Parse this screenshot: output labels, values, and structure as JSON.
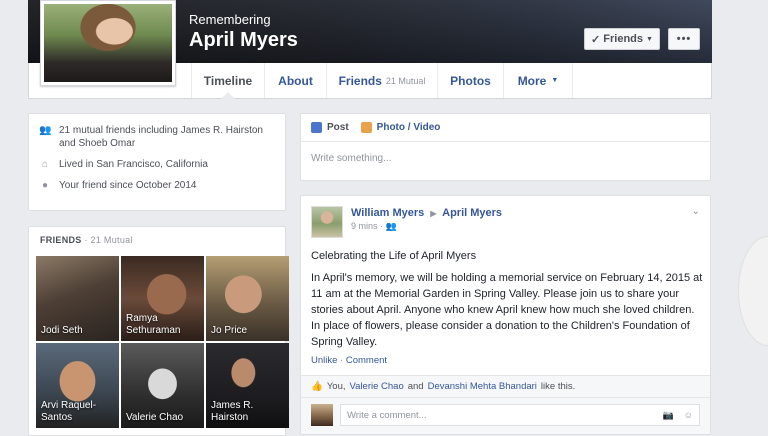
{
  "header": {
    "remembering": "Remembering",
    "name": "April Myers",
    "friends_button": "Friends",
    "more_button": "•••"
  },
  "tabs": [
    {
      "label": "Timeline",
      "sub": ""
    },
    {
      "label": "About",
      "sub": ""
    },
    {
      "label": "Friends",
      "sub": "21 Mutual"
    },
    {
      "label": "Photos",
      "sub": ""
    },
    {
      "label": "More",
      "sub": ""
    }
  ],
  "intro": {
    "mutual": "21 mutual friends including James R. Hairston and Shoeb Omar",
    "lived": "Lived in San Francisco, California",
    "since": "Your friend since October 2014"
  },
  "friends": {
    "title": "FRIENDS",
    "mutual": "· 21 Mutual",
    "people": [
      "Jodi Seth",
      "Ramya Sethuraman",
      "Jo Price",
      "Arvi Raquel-Santos",
      "Valerie Chao",
      "James R. Hairston"
    ]
  },
  "composer": {
    "post_tab": "Post",
    "photo_tab": "Photo / Video",
    "placeholder": "Write something..."
  },
  "post": {
    "author": "William Myers",
    "target": "April Myers",
    "time": "9 mins",
    "title": "Celebrating the Life of April Myers",
    "body": "In April's memory, we will be holding a memorial service on February 14, 2015 at 11 am at the Memorial Garden in Spring Valley. Please join us to share your stories about April. Anyone who knew April knew how much she loved children. In place of flowers, please consider a donation to the Children's Foundation of Spring Valley.",
    "unlike": "Unlike",
    "comment": "Comment",
    "likes_prefix": "You, ",
    "likes_name1": "Valerie Chao",
    "likes_and": " and ",
    "likes_name2": "Devanshi Mehta Bhandari",
    "likes_suffix": " like this.",
    "comment_placeholder": "Write a comment..."
  },
  "colors": {
    "link": "#365899",
    "background": "#e9ebee"
  }
}
